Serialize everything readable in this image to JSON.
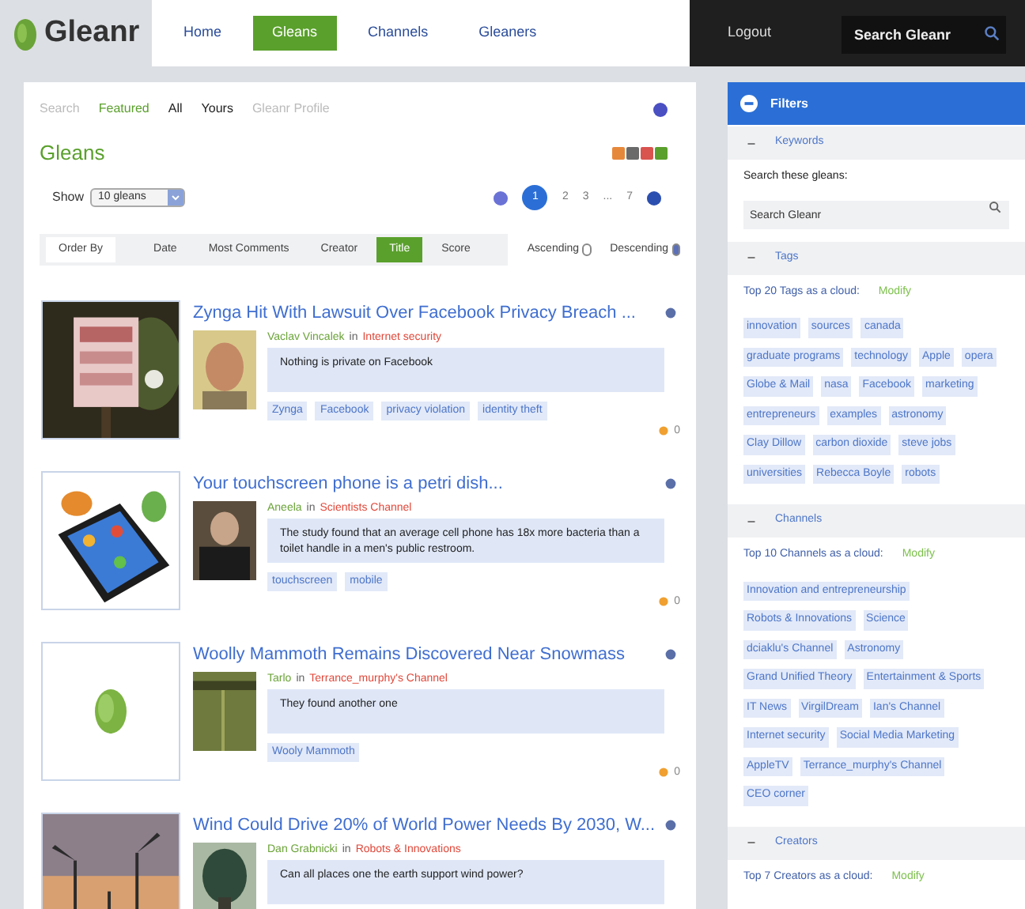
{
  "nav": {
    "logo": "Gleanr",
    "items": [
      {
        "label": "Home",
        "selected": false
      },
      {
        "label": "Gleans",
        "selected": true
      },
      {
        "label": "Channels",
        "selected": false
      },
      {
        "label": "Gleaners",
        "selected": false
      }
    ],
    "logout": "Logout",
    "search": {
      "placeholder": "Search Gleanr"
    }
  },
  "views": [
    {
      "label": "Search",
      "kind": "muted"
    },
    {
      "label": "Featured",
      "kind": "accent"
    },
    {
      "label": "All",
      "kind": "plain"
    },
    {
      "label": "Yours",
      "kind": "plain"
    },
    {
      "label": "Gleanr Profile",
      "kind": "muted"
    }
  ],
  "heading": "Gleans",
  "show": {
    "label": "Show",
    "value": "10 gleans"
  },
  "pager": [
    {
      "label": "1",
      "selected": true
    },
    {
      "label": "2",
      "selected": false
    },
    {
      "label": "3",
      "selected": false
    },
    {
      "label": "...",
      "selected": false
    },
    {
      "label": "7",
      "selected": false
    }
  ],
  "order": {
    "label": "Order By",
    "options": [
      {
        "label": "Date",
        "selected": false
      },
      {
        "label": "Most Comments",
        "selected": false
      },
      {
        "label": "Creator",
        "selected": false
      },
      {
        "label": "Title",
        "selected": true
      },
      {
        "label": "Score",
        "selected": false
      }
    ],
    "directions": [
      {
        "label": "Ascending",
        "selected": false
      },
      {
        "label": "Descending",
        "selected": true
      }
    ]
  },
  "gleans": [
    {
      "title": "Zynga Hit With Lawsuit Over Facebook Privacy Breach ...",
      "author": "Vaclav Vincalek",
      "in": "in",
      "channel": "Internet security",
      "text": "Nothing is private on Facebook",
      "tags": [
        "Zynga",
        "Facebook",
        "privacy violation",
        "identity theft"
      ],
      "score": "0"
    },
    {
      "title": "Your touchscreen phone is a petri dish...",
      "author": "Aneela",
      "in": "in",
      "channel": "Scientists Channel",
      "text": "The study found that an average cell phone has 18x more bacteria than a toilet handle in a men's public restroom.",
      "tags": [
        "touchscreen",
        "mobile"
      ],
      "score": "0"
    },
    {
      "title": "Woolly Mammoth Remains Discovered Near Snowmass",
      "author": "Tarlo",
      "in": "in",
      "channel": "Terrance_murphy's Channel",
      "text": "They found another one",
      "tags": [
        "Wooly Mammoth"
      ],
      "score": "0"
    },
    {
      "title": "Wind Could Drive 20% of World Power Needs By 2030, W...",
      "author": "Dan Grabnicki",
      "in": "in",
      "channel": "Robots & Innovations",
      "text": "Can all places one the earth support wind power?"
    }
  ],
  "filters": {
    "title": "Filters",
    "sections": [
      {
        "title": "Keywords",
        "expanded": true,
        "kind": "search",
        "label": "Search these gleans:",
        "placeholder": "Search Gleanr"
      },
      {
        "title": "Tags",
        "expanded": true,
        "kind": "cloud",
        "label": "Top 20 Tags as a cloud:",
        "modify": "Modify",
        "items": [
          "innovation",
          "sources",
          "canada",
          "graduate programs",
          "technology",
          "Apple",
          "opera",
          "Globe & Mail",
          "nasa",
          "Facebook",
          "marketing",
          "entrepreneurs",
          "examples",
          "astronomy",
          "Clay Dillow",
          "carbon dioxide",
          "steve jobs",
          "universities",
          "Rebecca Boyle",
          "robots"
        ]
      },
      {
        "title": "Channels",
        "expanded": true,
        "kind": "cloud",
        "label": "Top 10 Channels as a cloud:",
        "modify": "Modify",
        "items": [
          "Innovation and entrepreneurship",
          "Robots & Innovations",
          "Science",
          "dciaklu's Channel",
          "Astronomy",
          "Grand Unified Theory",
          "Entertainment & Sports",
          "IT News",
          "VirgilDream",
          "Ian's Channel",
          "Internet security",
          "Social Media Marketing",
          "AppleTV",
          "Terrance_murphy's Channel",
          "CEO corner"
        ]
      },
      {
        "title": "Creators",
        "expanded": true,
        "kind": "cloud",
        "label": "Top 7 Creators as a cloud:",
        "modify": "Modify"
      }
    ]
  }
}
